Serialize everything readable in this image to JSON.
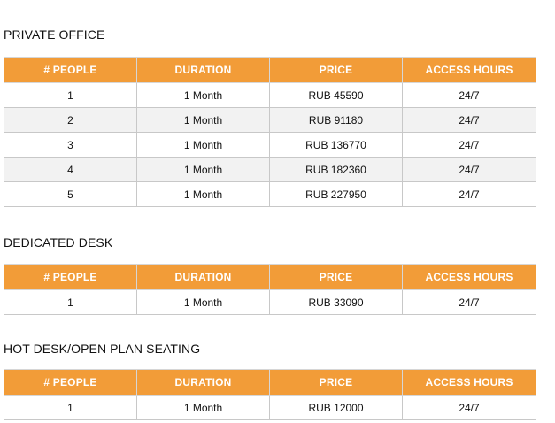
{
  "sections": [
    {
      "title": "PRIVATE OFFICE",
      "headers": [
        "# PEOPLE",
        "DURATION",
        "PRICE",
        "ACCESS HOURS"
      ],
      "rows": [
        [
          "1",
          "1 Month",
          "RUB 45590",
          "24/7"
        ],
        [
          "2",
          "1 Month",
          "RUB 91180",
          "24/7"
        ],
        [
          "3",
          "1 Month",
          "RUB 136770",
          "24/7"
        ],
        [
          "4",
          "1 Month",
          "RUB 182360",
          "24/7"
        ],
        [
          "5",
          "1 Month",
          "RUB 227950",
          "24/7"
        ]
      ]
    },
    {
      "title": "DEDICATED DESK",
      "headers": [
        "# PEOPLE",
        "DURATION",
        "PRICE",
        "ACCESS HOURS"
      ],
      "rows": [
        [
          "1",
          "1 Month",
          "RUB 33090",
          "24/7"
        ]
      ]
    },
    {
      "title": "HOT DESK/OPEN PLAN SEATING",
      "headers": [
        "# PEOPLE",
        "DURATION",
        "PRICE",
        "ACCESS HOURS"
      ],
      "rows": [
        [
          "1",
          "1 Month",
          "RUB 12000",
          "24/7"
        ]
      ]
    }
  ],
  "colors": {
    "header_background": "#f29c38",
    "header_text": "#ffffff",
    "alt_row_background": "#f2f2f2"
  }
}
